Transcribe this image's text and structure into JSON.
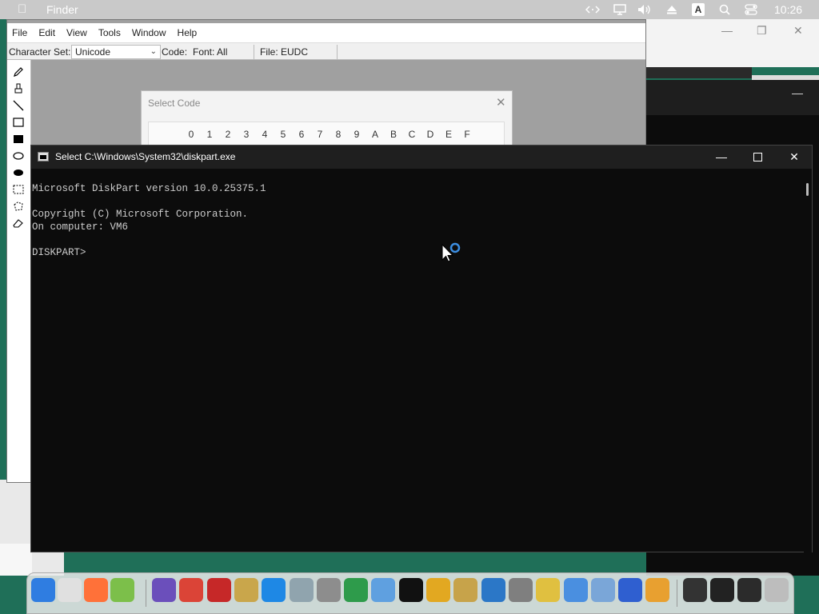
{
  "menubar": {
    "app_name": "Finder",
    "clock": "10:26",
    "input_badge": "A",
    "icons": [
      "code-arrows-icon",
      "display-icon",
      "volume-icon",
      "eject-icon",
      "input-source-icon",
      "search-icon",
      "control-center-icon"
    ]
  },
  "eudc": {
    "menu": [
      "File",
      "Edit",
      "View",
      "Tools",
      "Window",
      "Help"
    ],
    "charset_label": "Character Set:",
    "charset_value": "Unicode",
    "code_label": "Code:",
    "font_label": "Font: All",
    "file_label": "File: EUDC",
    "tools": [
      "pencil-icon",
      "brush-icon",
      "line-icon",
      "hollow-rect-icon",
      "filled-rect-icon",
      "hollow-ellipse-icon",
      "filled-ellipse-icon",
      "rect-select-icon",
      "freeform-select-icon",
      "eraser-icon"
    ]
  },
  "select_code": {
    "title": "Select Code",
    "hex_headers": [
      "0",
      "1",
      "2",
      "3",
      "4",
      "5",
      "6",
      "7",
      "8",
      "9",
      "A",
      "B",
      "C",
      "D",
      "E",
      "F"
    ]
  },
  "console": {
    "title": "Select C:\\Windows\\System32\\diskpart.exe",
    "lines": [
      "Microsoft DiskPart version 10.0.25375.1",
      "",
      "Copyright (C) Microsoft Corporation.",
      "On computer: VM6",
      "",
      "DISKPART>"
    ]
  },
  "dock": {
    "items": [
      {
        "name": "finder",
        "color": "#2f7de1"
      },
      {
        "name": "launchpad",
        "color": "#e0e0e0"
      },
      {
        "name": "firefox",
        "color": "#ff7139"
      },
      {
        "name": "preview",
        "color": "#7cbf4a"
      },
      {
        "name": "visual-studio",
        "color": "#6b4fbb"
      },
      {
        "name": "chrome",
        "color": "#db4437"
      },
      {
        "name": "app-red",
        "color": "#c62828"
      },
      {
        "name": "keychain",
        "color": "#c9a64b"
      },
      {
        "name": "notes-blue",
        "color": "#1e88e5"
      },
      {
        "name": "lambda",
        "color": "#90a4ae"
      },
      {
        "name": "printer",
        "color": "#8d8d8d"
      },
      {
        "name": "network-green",
        "color": "#2e9b4b"
      },
      {
        "name": "desktop-view",
        "color": "#5fa0e0"
      },
      {
        "name": "console-black",
        "color": "#111111"
      },
      {
        "name": "key-yellow",
        "color": "#e2a821"
      },
      {
        "name": "keys",
        "color": "#c7a34a"
      },
      {
        "name": "font-a",
        "color": "#2b77c7"
      },
      {
        "name": "server-add",
        "color": "#7f7f7f"
      },
      {
        "name": "certificate",
        "color": "#e0c040"
      },
      {
        "name": "components",
        "color": "#4a8fe0"
      },
      {
        "name": "monitor",
        "color": "#7aa6d8"
      },
      {
        "name": "x-tool",
        "color": "#2f5fd0"
      },
      {
        "name": "media",
        "color": "#e8a030"
      },
      {
        "name": "window-thumb-1",
        "color": "#333333"
      },
      {
        "name": "window-thumb-2",
        "color": "#222222"
      },
      {
        "name": "window-thumb-3",
        "color": "#2b2b2b"
      },
      {
        "name": "trash",
        "color": "#bdbdbd"
      }
    ]
  }
}
